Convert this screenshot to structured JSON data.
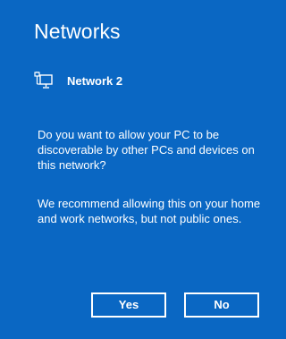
{
  "panel": {
    "title": "Networks",
    "network": {
      "icon": "wired-network-icon",
      "name": "Network 2"
    },
    "question": "Do you want to allow your PC to be discoverable by other PCs and devices on this network?",
    "recommendation": "We recommend allowing this on your home and work networks, but not public ones.",
    "buttons": {
      "yes_label": "Yes",
      "no_label": "No"
    }
  },
  "colors": {
    "background": "#0a67c3",
    "text": "#ffffff",
    "button_border": "#ffffff"
  }
}
